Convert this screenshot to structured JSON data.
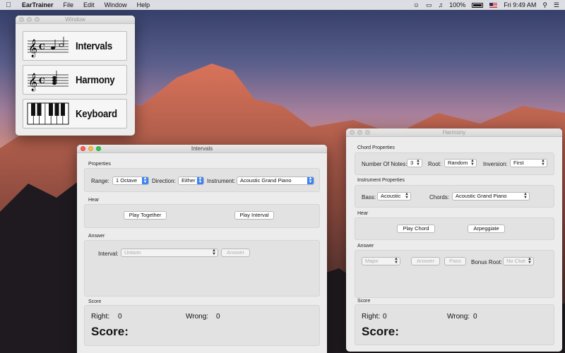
{
  "menubar": {
    "app_name": "EarTrainer",
    "items": [
      "File",
      "Edit",
      "Window",
      "Help"
    ],
    "battery": "100%",
    "clock": "Fri 9:49 AM"
  },
  "launcher": {
    "title": "Window",
    "buttons": [
      {
        "label": "Intervals",
        "icon": "staff-interval-icon"
      },
      {
        "label": "Harmony",
        "icon": "staff-chord-icon"
      },
      {
        "label": "Keyboard",
        "icon": "piano-keys-icon"
      }
    ]
  },
  "intervals": {
    "title": "Intervals",
    "properties_title": "Properties",
    "range_label": "Range:",
    "range_value": "1 Octave",
    "direction_label": "Direction:",
    "direction_value": "Either",
    "instrument_label": "Instrument:",
    "instrument_value": "Acoustic Grand Piano",
    "hear_title": "Hear",
    "play_together": "Play Together",
    "play_interval": "Play Interval",
    "answer_title": "Answer",
    "interval_label": "Interval:",
    "interval_value": "Unison",
    "answer_button": "Answer",
    "score_title": "Score",
    "right_label": "Right:",
    "right_value": "0",
    "wrong_label": "Wrong:",
    "wrong_value": "0",
    "score_label": "Score:"
  },
  "harmony": {
    "title": "Harmony",
    "chord_props_title": "Chord Properties",
    "num_notes_label": "Number Of Notes:",
    "num_notes_value": "3",
    "root_label": "Root:",
    "root_value": "Random",
    "inversion_label": "Inversion:",
    "inversion_value": "First",
    "instr_props_title": "Instrument Properties",
    "bass_label": "Bass:",
    "bass_value": "Acoustic",
    "chords_label": "Chords:",
    "chords_value": "Acoustic Grand Piano",
    "hear_title": "Hear",
    "play_chord": "Play Chord",
    "arpeggiate": "Arpeggiate",
    "answer_title": "Answer",
    "quality_value": "Major",
    "answer_button": "Answer",
    "pass_button": "Pass",
    "bonus_root_label": "Bonus Root:",
    "bonus_root_value": "No Clue",
    "score_title": "Score",
    "right_label": "Right:",
    "right_value": "0",
    "wrong_label": "Wrong:",
    "wrong_value": "0",
    "score_label": "Score:"
  },
  "colors": {
    "accent": "#3d83f5",
    "close": "#fc605c",
    "minimize": "#fdbc40",
    "zoom": "#34c84a"
  }
}
